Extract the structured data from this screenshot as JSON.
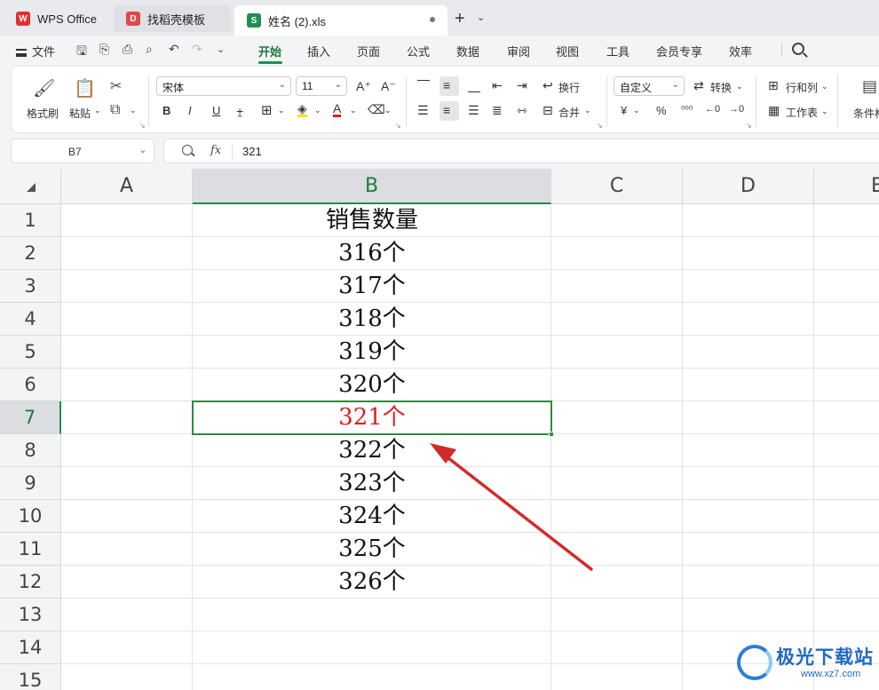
{
  "tabs": [
    {
      "label": "WPS Office",
      "icon": "wps-logo-icon"
    },
    {
      "label": "找稻壳模板",
      "icon": "docer-icon"
    },
    {
      "label": "姓名 (2).xls",
      "icon": "spreadsheet-icon"
    }
  ],
  "menu": {
    "file": "文件",
    "items": [
      "开始",
      "插入",
      "页面",
      "公式",
      "数据",
      "审阅",
      "视图",
      "工具",
      "会员专享",
      "效率"
    ],
    "active": "开始"
  },
  "ribbon": {
    "format_painter": "格式刷",
    "paste": "粘贴",
    "font_name": "宋体",
    "font_size": "11",
    "bold": "B",
    "italic": "I",
    "underline": "U",
    "wrap": "换行",
    "merge": "合并",
    "number_format": "自定义",
    "convert": "转换",
    "rows_cols": "行和列",
    "worksheet": "工作表",
    "conditional": "条件格",
    "currency": "¥",
    "percent": "%"
  },
  "formula_bar": {
    "cell_ref": "B7",
    "fx": "fx",
    "value": "321"
  },
  "columns": [
    "A",
    "B",
    "C",
    "D",
    "E"
  ],
  "rows": [
    "1",
    "2",
    "3",
    "4",
    "5",
    "6",
    "7",
    "8",
    "9",
    "10",
    "11",
    "12",
    "13",
    "14",
    "15"
  ],
  "column_b": [
    "销售数量",
    "316个",
    "317个",
    "318个",
    "319个",
    "320个",
    "321个",
    "322个",
    "323个",
    "324个",
    "325个",
    "326个"
  ],
  "selected_cell": {
    "column": "B",
    "row": 7
  },
  "colors": {
    "accent": "#1e8f4e",
    "selection": "#2e8b3e",
    "highlight_text": "#e02020",
    "arrow": "#d42a2a"
  },
  "watermark": {
    "name": "极光下载站",
    "url": "www.xz7.com"
  }
}
